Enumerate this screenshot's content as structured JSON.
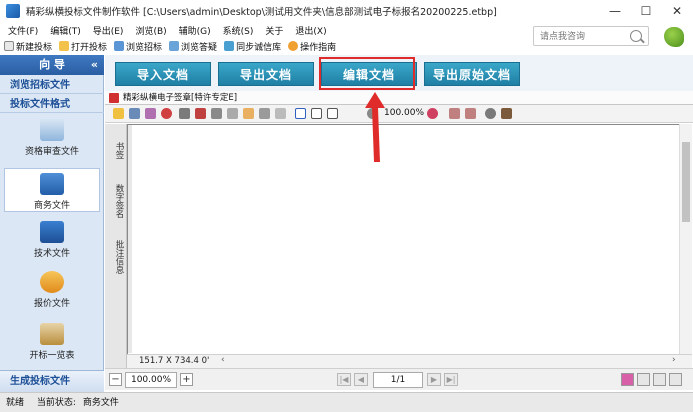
{
  "window": {
    "title": "精彩纵横投标文件制作软件 [C:\\Users\\admin\\Desktop\\测试用文件夹\\信息部测试电子标报名20200225.etbp]",
    "minimize": "—",
    "maximize": "☐",
    "close": "✕"
  },
  "menu": [
    "文件(F)",
    "编辑(T)",
    "导出(E)",
    "浏览(B)",
    "辅助(G)",
    "系统(S)",
    "关于",
    "退出(X)"
  ],
  "toolbar": [
    "新建投标",
    "打开投标",
    "浏览招标",
    "浏览答疑",
    "同步诚信库",
    "操作指南"
  ],
  "search": {
    "placeholder": "请点我咨询"
  },
  "sidebar": {
    "header": "向 导",
    "collapse": "«",
    "group_browse": "浏览招标文件",
    "group_format": "投标文件格式",
    "items": [
      "资格审查文件",
      "商务文件",
      "技术文件",
      "报价文件",
      "开标一览表"
    ],
    "footer": "生成投标文件"
  },
  "main": {
    "buttons": [
      "导入文档",
      "导出文档",
      "编辑文档",
      "导出原始文档"
    ],
    "doc_title": "精彩纵横电子签章[特许专定E]",
    "zoom": "100.00%",
    "tabs": [
      "书签",
      "数字签名",
      "批注信息"
    ],
    "coords": "151.7 X 734.4 0'",
    "bottom_zoom": "100.00%",
    "page": "1/1"
  },
  "status": {
    "ready": "就绪",
    "current_label": "当前状态:",
    "current_value": "商务文件"
  },
  "colors": {
    "accent": "#2b5ea3",
    "button": "#2a8fb6",
    "highlight": "#e02b2b"
  }
}
